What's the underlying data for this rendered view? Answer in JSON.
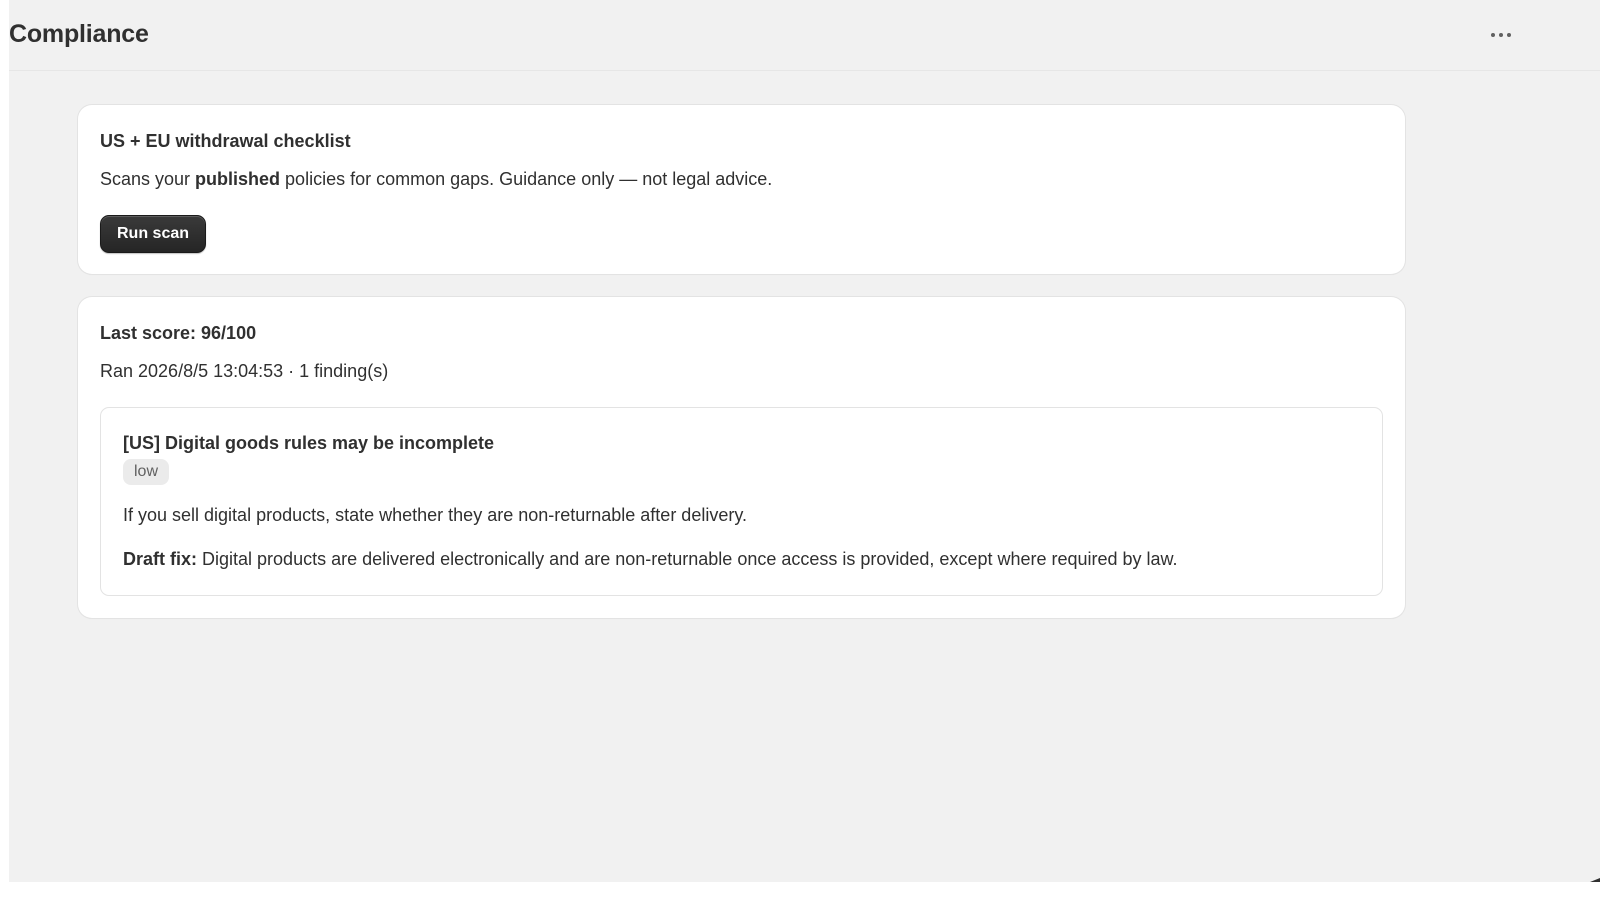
{
  "header": {
    "title": "Compliance",
    "more_icon": "more-horizontal-icon"
  },
  "checklist": {
    "title": "US + EU withdrawal checklist",
    "description_prefix": "Scans your ",
    "description_bold": "published",
    "description_suffix": " policies for common gaps. Guidance only — not legal advice.",
    "run_scan_label": "Run scan"
  },
  "results": {
    "score_label": "Last score: 96/100",
    "meta": "Ran 2026/8/5 13:04:53 · 1 finding(s)",
    "findings": [
      {
        "title": "[US] Digital goods rules may be incomplete",
        "severity": "low",
        "description": "If you sell digital products, state whether they are non-returnable after delivery.",
        "fix_label": "Draft fix:",
        "fix_text": " Digital products are delivered electronically and are non-returnable once access is provided, except where required by law."
      }
    ]
  },
  "colors": {
    "page_background": "#f1f1f1",
    "card_background": "#ffffff",
    "primary_button": "#303030",
    "badge_background": "#ebebeb"
  }
}
